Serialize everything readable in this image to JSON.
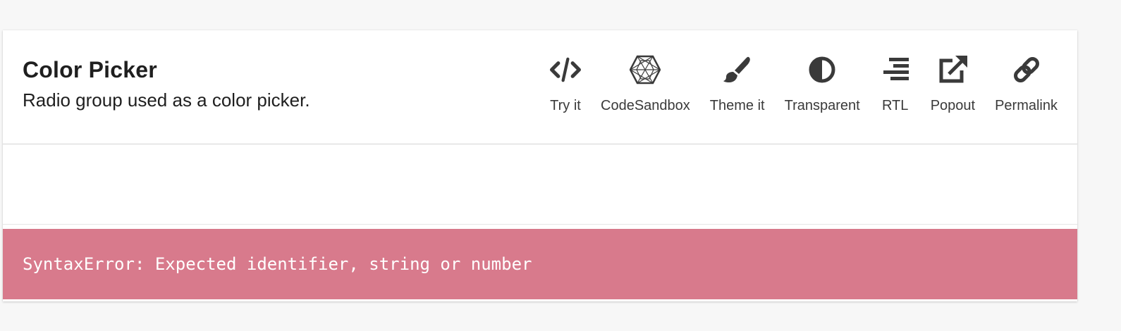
{
  "demo": {
    "title": "Color Picker",
    "description": "Radio group used as a color picker."
  },
  "actions": [
    {
      "label": "Try it",
      "icon": "code-icon"
    },
    {
      "label": "CodeSandbox",
      "icon": "codesandbox-icon"
    },
    {
      "label": "Theme it",
      "icon": "paintbrush-icon"
    },
    {
      "label": "Transparent",
      "icon": "adjust-contrast-icon"
    },
    {
      "label": "RTL",
      "icon": "align-right-icon"
    },
    {
      "label": "Popout",
      "icon": "external-link-icon"
    },
    {
      "label": "Permalink",
      "icon": "link-icon"
    }
  ],
  "error": {
    "message": "SyntaxError: Expected identifier, string or number"
  },
  "colors": {
    "background": "#f7f7f7",
    "card": "#ffffff",
    "error_bg": "#d87a8c",
    "error_text": "#ffffff",
    "icon": "#3a3a3a"
  }
}
